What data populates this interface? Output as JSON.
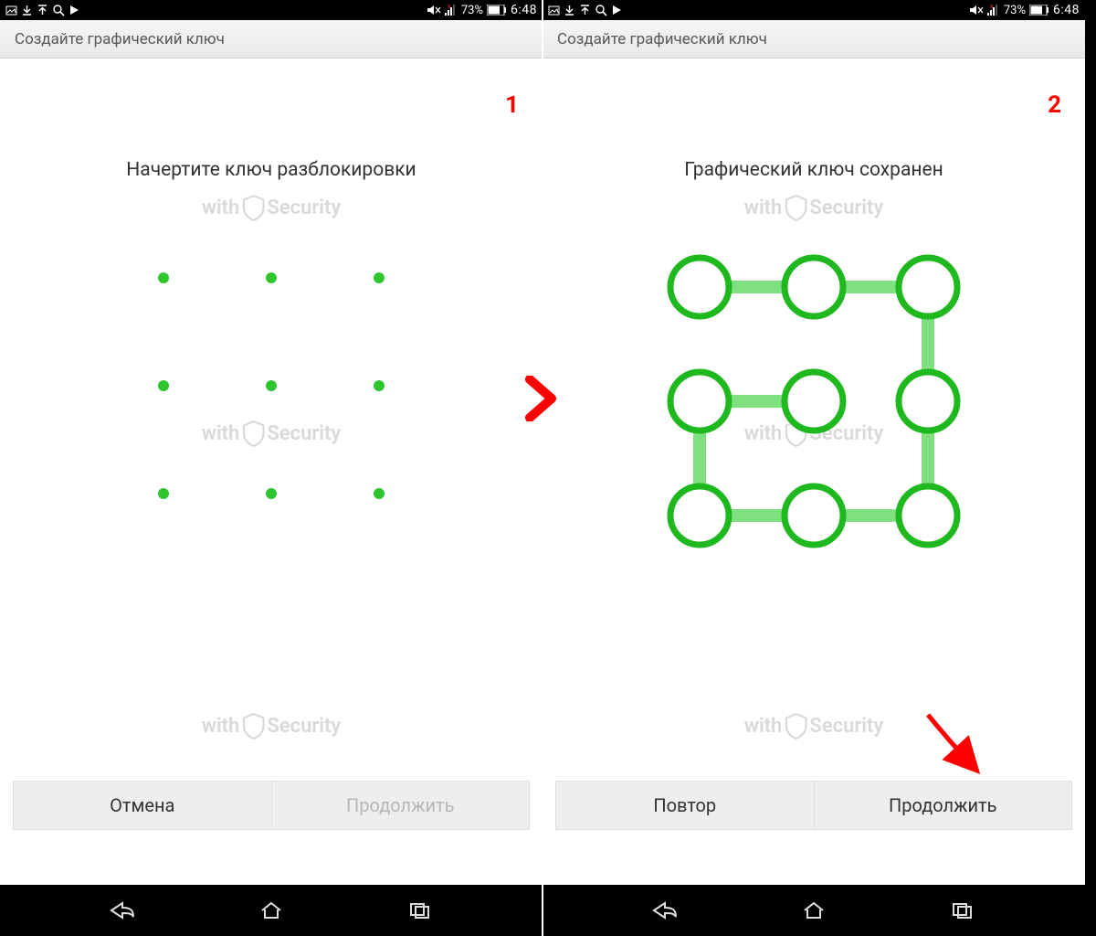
{
  "status": {
    "battery_percent": "73%",
    "time": "6:48"
  },
  "title": "Создайте графический ключ",
  "watermark": {
    "prefix": "with",
    "word": "Security"
  },
  "screens": [
    {
      "step": "1",
      "instruction": "Начертите ключ разблокировки",
      "buttons": {
        "left": "Отмена",
        "right": "Продолжить"
      },
      "right_disabled": true,
      "pattern_drawn": false
    },
    {
      "step": "2",
      "instruction": "Графический ключ сохранен",
      "buttons": {
        "left": "Повтор",
        "right": "Продолжить"
      },
      "right_disabled": false,
      "pattern_drawn": true
    }
  ],
  "colors": {
    "pattern_green": "#1fb81f",
    "pattern_line": "#7fe07f",
    "annotation_red": "#ff0000"
  },
  "pattern_path_nodes": [
    1,
    2,
    3,
    6,
    9,
    8,
    7,
    4,
    5
  ]
}
